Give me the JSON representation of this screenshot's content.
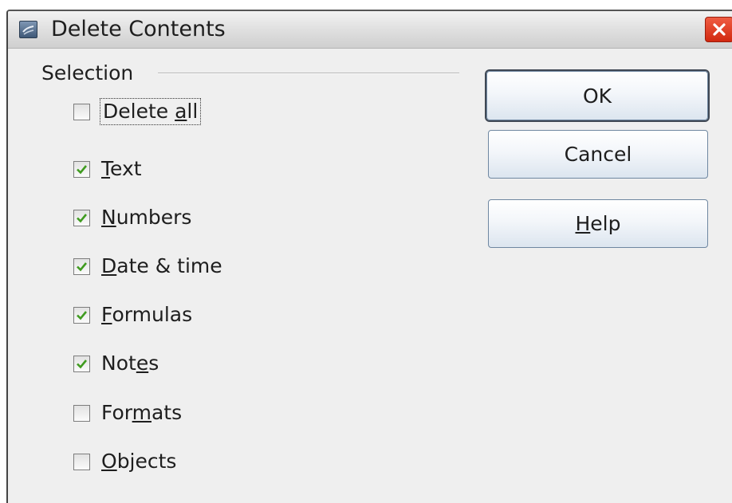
{
  "window": {
    "title": "Delete Contents",
    "app_icon": "document-window-icon",
    "close_icon": "close-icon"
  },
  "selection": {
    "label": "Selection",
    "options": [
      {
        "before": "Delete ",
        "mnemonic": "a",
        "after": "ll",
        "checked": false,
        "focused": true
      },
      {
        "before": "",
        "mnemonic": "T",
        "after": "ext",
        "checked": true
      },
      {
        "before": "",
        "mnemonic": "N",
        "after": "umbers",
        "checked": true
      },
      {
        "before": "",
        "mnemonic": "D",
        "after": "ate & time",
        "checked": true
      },
      {
        "before": "",
        "mnemonic": "F",
        "after": "ormulas",
        "checked": true
      },
      {
        "before": "Not",
        "mnemonic": "e",
        "after": "s",
        "checked": true
      },
      {
        "before": "For",
        "mnemonic": "m",
        "after": "ats",
        "checked": false
      },
      {
        "before": "",
        "mnemonic": "O",
        "after": "bjects",
        "checked": false
      }
    ]
  },
  "buttons": {
    "ok": "OK",
    "cancel": "Cancel",
    "help_mnemonic": "H",
    "help_rest": "elp"
  },
  "colors": {
    "close_button": "#d9351b",
    "checkmark": "#3f9b1f",
    "button_border": "#6f87a1"
  }
}
